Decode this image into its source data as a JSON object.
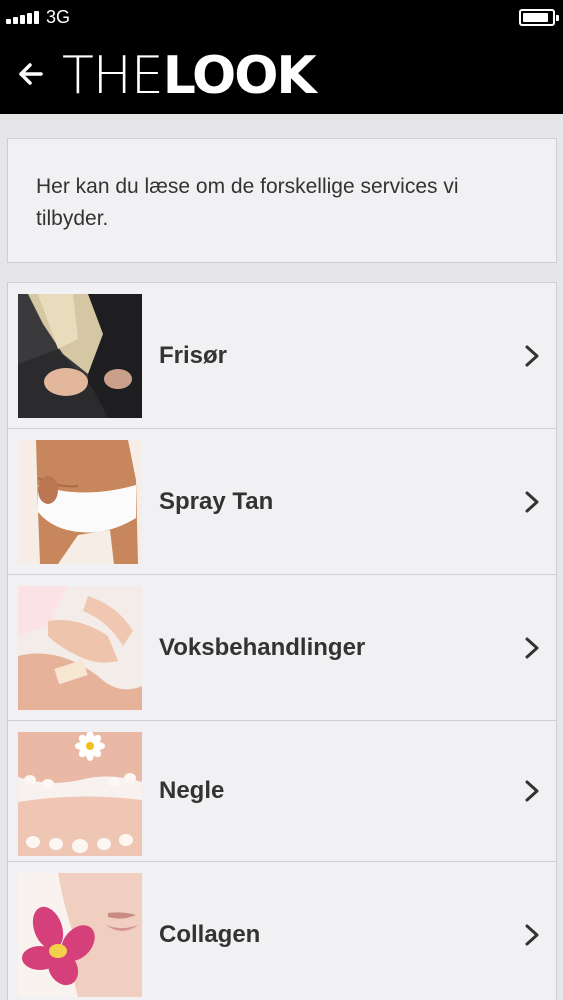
{
  "status_bar": {
    "network": "3G",
    "signal_bars": 5,
    "battery_level": 0.9
  },
  "header": {
    "back_icon": "arrow-left-icon",
    "logo_thin": "THE",
    "logo_bold": "LOOK"
  },
  "intro": {
    "text": "Her kan du læse om de forskellige services vi tilbyder."
  },
  "services": [
    {
      "label": "Frisør",
      "image": "hair-photo"
    },
    {
      "label": "Spray Tan",
      "image": "tan-photo"
    },
    {
      "label": "Voksbehandlinger",
      "image": "waxing-photo"
    },
    {
      "label": "Negle",
      "image": "nails-photo"
    },
    {
      "label": "Collagen",
      "image": "collagen-photo"
    }
  ],
  "colors": {
    "header_bg": "#000000",
    "page_bg": "#e6e6e8",
    "card_bg": "#f1f1f3",
    "text": "#333333"
  }
}
